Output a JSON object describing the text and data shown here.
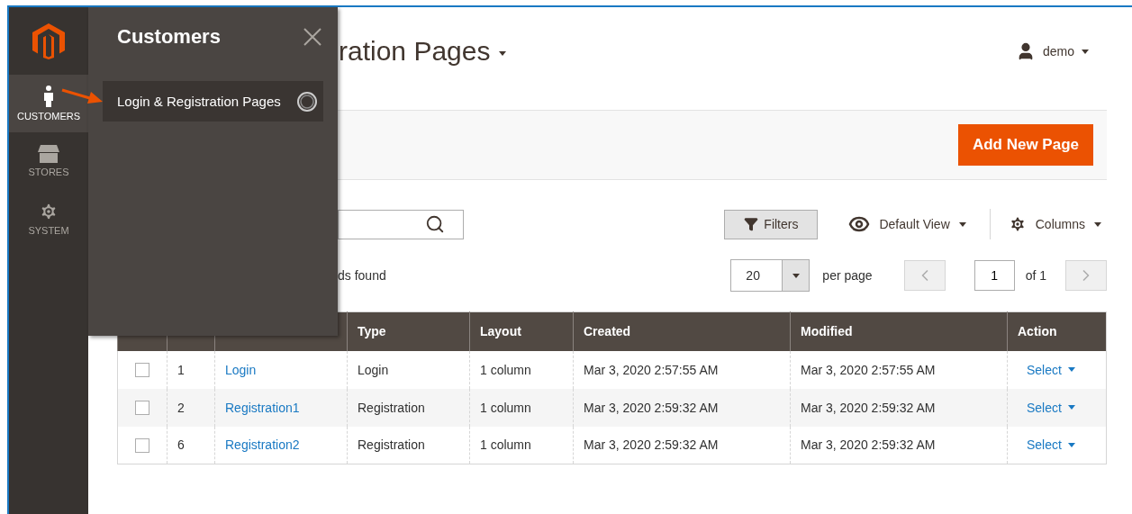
{
  "sidebar": {
    "items": [
      {
        "kind": "person",
        "label": "CUSTOMERS",
        "selected": true
      },
      {
        "kind": "store",
        "label": "STORES",
        "selected": false
      },
      {
        "kind": "gear",
        "label": "SYSTEM",
        "selected": false
      }
    ]
  },
  "flyout": {
    "title": "Customers",
    "items": [
      {
        "label": "Login & Registration Pages",
        "loading": true
      }
    ]
  },
  "header": {
    "title": "ration Pages",
    "user": "demo"
  },
  "actions": {
    "primary": "Add New Page"
  },
  "toolbar": {
    "filters": "Filters",
    "view": "Default View",
    "columns": "Columns"
  },
  "pager": {
    "records": "ds found",
    "per_page": "20",
    "per_page_label": "per page",
    "page": "1",
    "of": "of 1"
  },
  "table": {
    "columns": [
      "Type",
      "Layout",
      "Created",
      "Modified",
      "Action"
    ],
    "rows": [
      {
        "checked": false,
        "id": "1",
        "title": "Login",
        "type": "Login",
        "layout": "1 column",
        "created": "Mar 3, 2020 2:57:55 AM",
        "modified": "Mar 3, 2020 2:57:55 AM",
        "action": "Select"
      },
      {
        "checked": false,
        "id": "2",
        "title": "Registration1",
        "type": "Registration",
        "layout": "1 column",
        "created": "Mar 3, 2020 2:59:32 AM",
        "modified": "Mar 3, 2020 2:59:32 AM",
        "action": "Select"
      },
      {
        "checked": false,
        "id": "6",
        "title": "Registration2",
        "type": "Registration",
        "layout": "1 column",
        "created": "Mar 3, 2020 2:59:32 AM",
        "modified": "Mar 3, 2020 2:59:32 AM",
        "action": "Select"
      }
    ]
  }
}
